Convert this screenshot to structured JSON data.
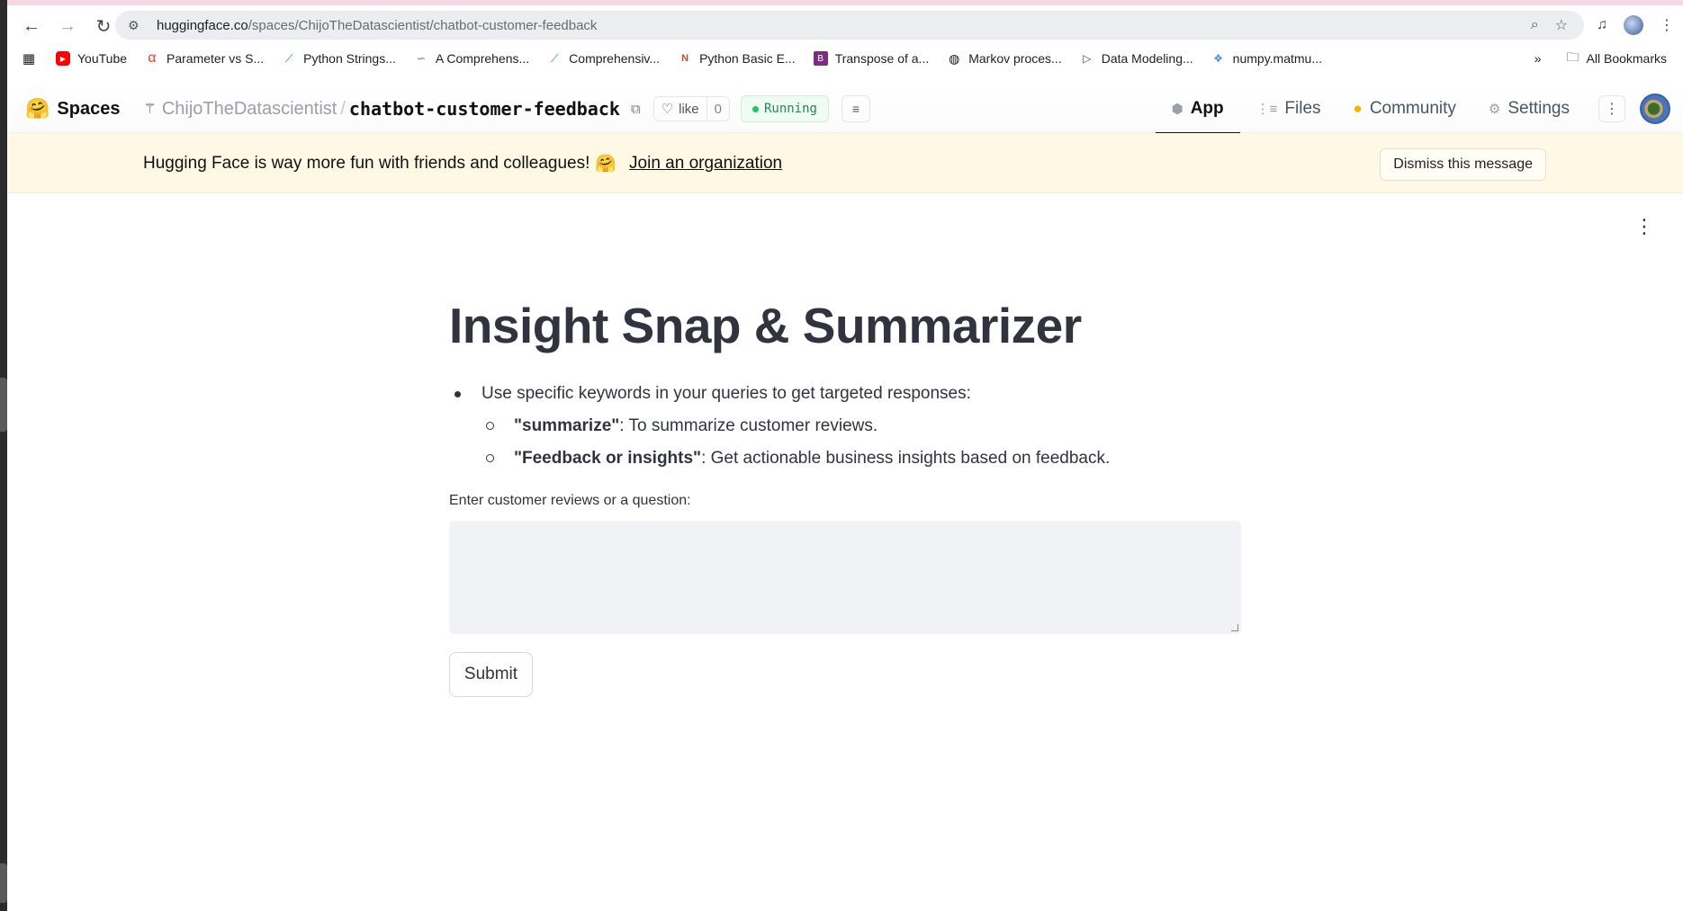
{
  "browser": {
    "url_host": "huggingface.co",
    "url_path": "/spaces/ChijoTheDatascientist/chatbot-customer-feedback",
    "bookmarks": [
      {
        "label": "YouTube",
        "icon": "youtube-icon",
        "color": "#ff0000"
      },
      {
        "label": "Parameter vs S...",
        "icon": "alpha-icon",
        "color": "#e8402f"
      },
      {
        "label": "Python Strings...",
        "icon": "trend-icon",
        "color": "#1a73e8"
      },
      {
        "label": "A Comprehens...",
        "icon": "wave-icon",
        "color": "#3c8c5a"
      },
      {
        "label": "Comprehensiv...",
        "icon": "trend-icon",
        "color": "#1a73e8"
      },
      {
        "label": "Python Basic E...",
        "icon": "nb-icon",
        "color": "#d4472b"
      },
      {
        "label": "Transpose of a...",
        "icon": "book-icon",
        "color": "#7b2d7e"
      },
      {
        "label": "Markov proces...",
        "icon": "globe-icon",
        "color": "#111111"
      },
      {
        "label": "Data Modeling...",
        "icon": "play-icon",
        "color": "#4a4a4a"
      },
      {
        "label": "numpy.matmu...",
        "icon": "cube-icon",
        "color": "#4a90d9"
      }
    ],
    "all_bookmarks": "All Bookmarks"
  },
  "hf": {
    "spaces_label": "Spaces",
    "owner": "ChijoTheDatascientist",
    "repo": "chatbot-customer-feedback",
    "like_label": "like",
    "like_count": "0",
    "status": "Running",
    "tabs": [
      {
        "label": "App",
        "icon": "app-icon",
        "active": true
      },
      {
        "label": "Files",
        "icon": "files-icon",
        "active": false
      },
      {
        "label": "Community",
        "icon": "community-icon",
        "active": false
      },
      {
        "label": "Settings",
        "icon": "settings-icon",
        "active": false
      }
    ]
  },
  "banner": {
    "text": "Hugging Face is way more fun with friends and colleagues!",
    "emoji": "🤗",
    "link": "Join an organization",
    "dismiss": "Dismiss this message"
  },
  "app": {
    "title": "Insight Snap & Summarizer",
    "intro": "Use specific keywords in your queries to get targeted responses:",
    "items": [
      {
        "keyword": "\"summarize\"",
        "text": ": To summarize customer reviews."
      },
      {
        "keyword": "\"Feedback or insights\"",
        "text": ": Get actionable business insights based on feedback."
      }
    ],
    "field_label": "Enter customer reviews or a question:",
    "field_value": "",
    "submit": "Submit"
  }
}
